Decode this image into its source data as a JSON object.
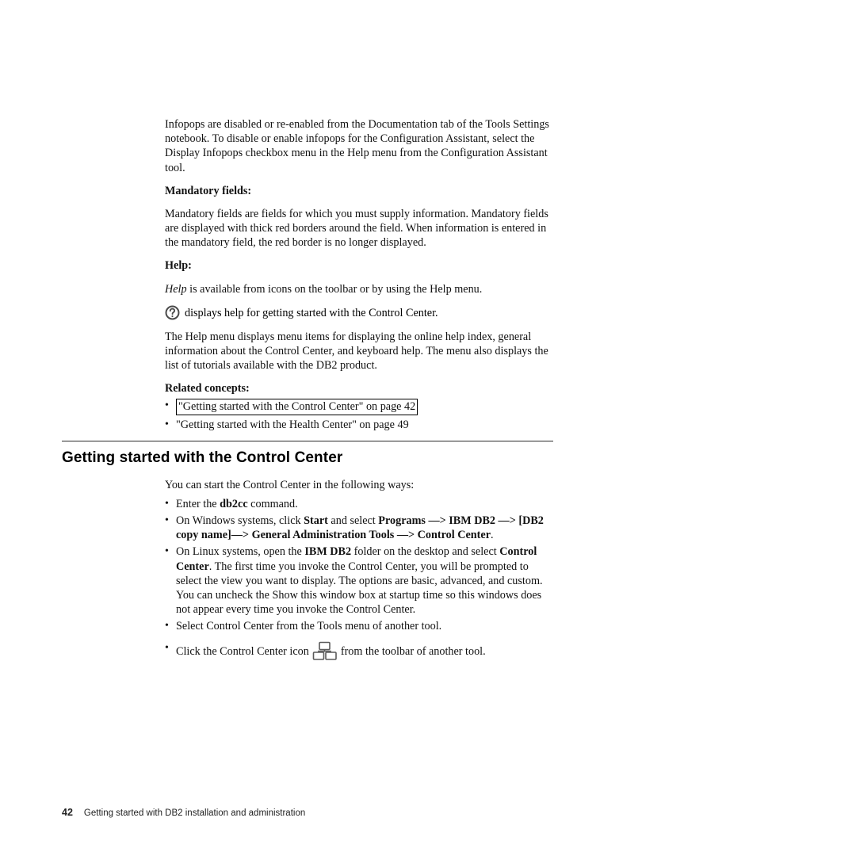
{
  "para_infopops": "Infopops are disabled or re-enabled from the Documentation tab of the Tools Settings notebook. To disable or enable infopops for the Configuration Assistant, select the Display Infopops checkbox menu in the Help menu from the Configuration Assistant tool.",
  "heading_mandatory": "Mandatory fields:",
  "para_mandatory": "Mandatory fields are fields for which you must supply information. Mandatory fields are displayed with thick red borders around the field. When information is entered in the mandatory field, the red border is no longer displayed.",
  "heading_help": "Help:",
  "help_para_prefix_italic": "Help",
  "help_para_rest": " is available from icons on the toolbar or by using the Help menu.",
  "help_icon_line": " displays help for getting started with the Control Center.",
  "para_helpmenu": "The Help menu displays menu items for displaying the online help index, general information about the Control Center, and keyboard help. The menu also displays the list of tutorials available with the DB2 product.",
  "related_heading": "Related concepts:",
  "related_links": [
    {
      "text": "\"Getting started with the Control Center\" on page 42",
      "boxed": true
    },
    {
      "text": "\"Getting started with the Health Center\" on page 49",
      "boxed": false
    }
  ],
  "section_title": "Getting started with the Control Center",
  "intro_ways": "You can start the Control Center in the following ways:",
  "ways": {
    "b1_pre": "Enter the ",
    "b1_bold": "db2cc",
    "b1_post": " command.",
    "b2_a": "On Windows systems, click ",
    "b2_start": "Start",
    "b2_b": " and select ",
    "b2_path": "Programs —> IBM DB2 —> [DB2 copy name]—> General Administration Tools —> Control Center",
    "b2_end": ".",
    "b3_a": "On Linux systems, open the ",
    "b3_bold1": "IBM DB2",
    "b3_b": " folder on the desktop and select ",
    "b3_bold2": "Control Center",
    "b3_c": ". The first time you invoke the Control Center, you will be prompted to select the view you want to display. The options are basic, advanced, and custom. You can uncheck the Show this window box at startup time so this windows does not appear every time you invoke the Control Center.",
    "b4": "Select Control Center from the Tools menu of another tool.",
    "b5_a": "Click the Control Center icon ",
    "b5_b": " from the toolbar of another tool."
  },
  "footer": {
    "page": "42",
    "title": "Getting started with DB2 installation and administration"
  }
}
